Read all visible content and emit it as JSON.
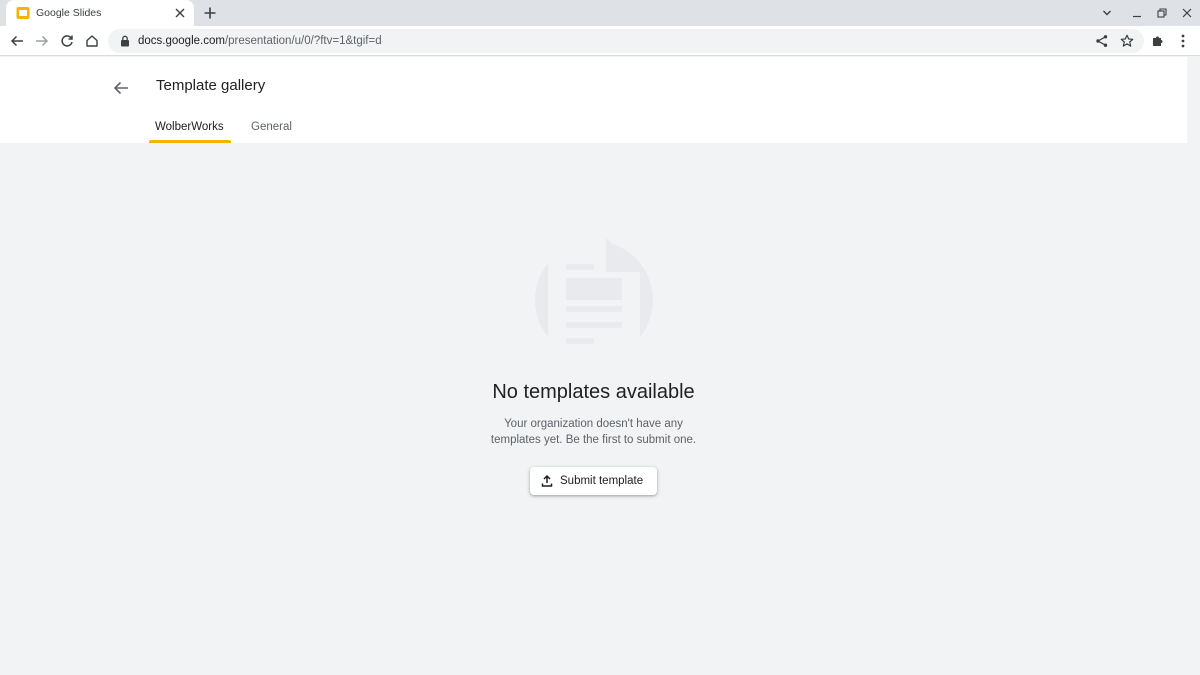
{
  "browser": {
    "tab": {
      "title": "Google Slides",
      "favicon": "google-slides-icon",
      "favicon_color": "#f4b400"
    },
    "url_host": "docs.google.com",
    "url_path": "/presentation/u/0/?ftv=1&tgif=d"
  },
  "header": {
    "title": "Template gallery",
    "tabs": [
      {
        "label": "WolberWorks",
        "active": true
      },
      {
        "label": "General",
        "active": false
      }
    ],
    "active_tab_color": "#f4b400"
  },
  "empty_state": {
    "title": "No templates available",
    "description_line1": "Your organization doesn't have any",
    "description_line2": "templates yet. Be the first to submit one.",
    "button_label": "Submit template"
  }
}
